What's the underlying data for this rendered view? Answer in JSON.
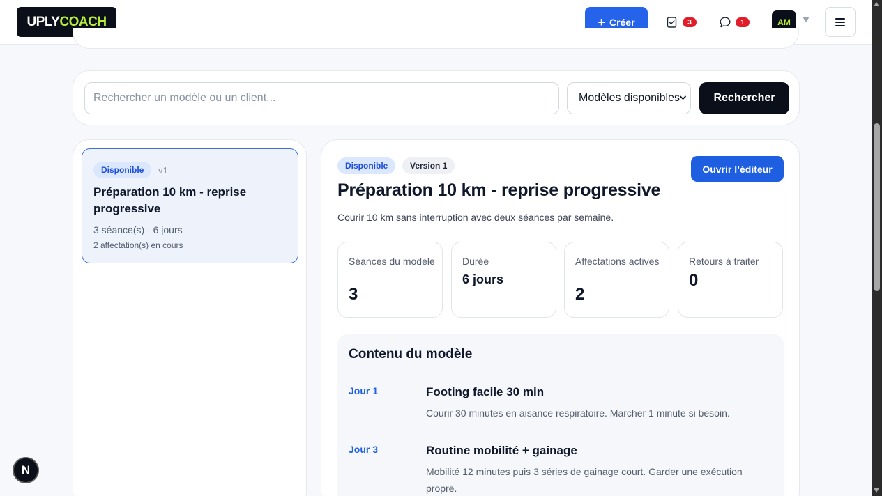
{
  "header": {
    "logo_part1": "UPLY",
    "logo_part2": "COACH",
    "create_label": "Créer",
    "tasks_count": "3",
    "messages_count": "1",
    "avatar_initials": "AM"
  },
  "search": {
    "placeholder": "Rechercher un modèle ou un client...",
    "value": "",
    "filter_selected": "Modèles disponibles",
    "button_label": "Rechercher"
  },
  "list": {
    "items": [
      {
        "status": "Disponible",
        "version": "v1",
        "title": "Préparation 10 km - reprise progressive",
        "meta": "3 séance(s) · 6 jours",
        "sub": "2 affectation(s) en cours"
      }
    ]
  },
  "detail": {
    "status": "Disponible",
    "version": "Version 1",
    "open_editor_label": "Ouvrir l’éditeur",
    "title": "Préparation 10 km - reprise progressive",
    "description": "Courir 10 km sans interruption avec deux séances par semaine.",
    "stats": [
      {
        "label": "Séances du modèle",
        "value": "3"
      },
      {
        "label": "Durée",
        "value": "6 jours"
      },
      {
        "label": "Affectations actives",
        "value": "2"
      },
      {
        "label": "Retours à traiter",
        "value": "0"
      }
    ],
    "content_title": "Contenu du modèle",
    "sessions": [
      {
        "day": "Jour 1",
        "name": "Footing facile 30 min",
        "desc": "Courir 30 minutes en aisance respiratoire. Marcher 1 minute si besoin."
      },
      {
        "day": "Jour 3",
        "name": "Routine mobilité + gainage",
        "desc": "Mobilité 12 minutes puis 3 séries de gainage court. Garder une exécution propre."
      }
    ]
  },
  "dev_badge": "N",
  "colors": {
    "accent": "#2563eb",
    "brand_green": "#b7ec3a",
    "dark": "#0b0f19",
    "badge_red": "#e11d2a"
  }
}
